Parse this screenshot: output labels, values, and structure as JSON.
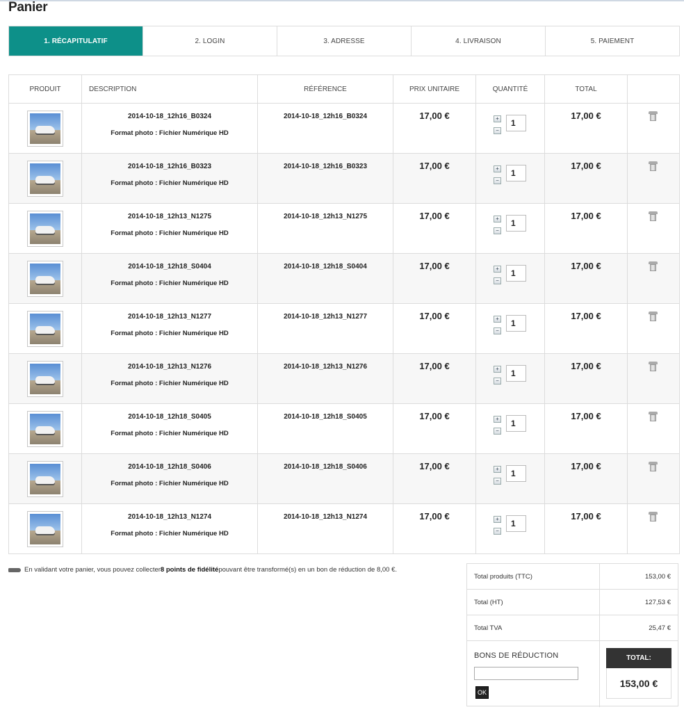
{
  "page": {
    "title": "Panier"
  },
  "steps": [
    {
      "label": "1. Récapitulatif",
      "active": true
    },
    {
      "label": "2. Login",
      "active": false
    },
    {
      "label": "3. Adresse",
      "active": false
    },
    {
      "label": "4. Livraison",
      "active": false
    },
    {
      "label": "5. Paiement",
      "active": false
    }
  ],
  "table": {
    "headers": {
      "product": "Produit",
      "description": "Description",
      "reference": "Référence",
      "unit_price": "Prix unitaire",
      "quantity": "Quantité",
      "total": "Total"
    },
    "plus_glyph": "+",
    "minus_glyph": "−",
    "rows": [
      {
        "name": "2014-10-18_12h16_B0324",
        "format": "Format photo : Fichier Numérique HD",
        "reference": "2014-10-18_12h16_B0324",
        "unit_price": "17,00 €",
        "quantity": "1",
        "total": "17,00 €"
      },
      {
        "name": "2014-10-18_12h16_B0323",
        "format": "Format photo : Fichier Numérique HD",
        "reference": "2014-10-18_12h16_B0323",
        "unit_price": "17,00 €",
        "quantity": "1",
        "total": "17,00 €"
      },
      {
        "name": "2014-10-18_12h13_N1275",
        "format": "Format photo : Fichier Numérique HD",
        "reference": "2014-10-18_12h13_N1275",
        "unit_price": "17,00 €",
        "quantity": "1",
        "total": "17,00 €"
      },
      {
        "name": "2014-10-18_12h18_S0404",
        "format": "Format photo : Fichier Numérique HD",
        "reference": "2014-10-18_12h18_S0404",
        "unit_price": "17,00 €",
        "quantity": "1",
        "total": "17,00 €"
      },
      {
        "name": "2014-10-18_12h13_N1277",
        "format": "Format photo : Fichier Numérique HD",
        "reference": "2014-10-18_12h13_N1277",
        "unit_price": "17,00 €",
        "quantity": "1",
        "total": "17,00 €"
      },
      {
        "name": "2014-10-18_12h13_N1276",
        "format": "Format photo : Fichier Numérique HD",
        "reference": "2014-10-18_12h13_N1276",
        "unit_price": "17,00 €",
        "quantity": "1",
        "total": "17,00 €"
      },
      {
        "name": "2014-10-18_12h18_S0405",
        "format": "Format photo : Fichier Numérique HD",
        "reference": "2014-10-18_12h18_S0405",
        "unit_price": "17,00 €",
        "quantity": "1",
        "total": "17,00 €"
      },
      {
        "name": "2014-10-18_12h18_S0406",
        "format": "Format photo : Fichier Numérique HD",
        "reference": "2014-10-18_12h18_S0406",
        "unit_price": "17,00 €",
        "quantity": "1",
        "total": "17,00 €"
      },
      {
        "name": "2014-10-18_12h13_N1274",
        "format": "Format photo : Fichier Numérique HD",
        "reference": "2014-10-18_12h13_N1274",
        "unit_price": "17,00 €",
        "quantity": "1",
        "total": "17,00 €"
      }
    ]
  },
  "loyalty": {
    "before": "En validant votre panier, vous pouvez collecter ",
    "points": "8 points de fidélité",
    "after": " pouvant être transformé(s) en un bon de réduction de 8,00 €."
  },
  "totals": {
    "products_ttc_label": "Total produits (TTC)",
    "products_ttc_value": "153,00 €",
    "ht_label": "Total (HT)",
    "ht_value": "127,53 €",
    "tva_label": "Total TVA",
    "tva_value": "25,47 €",
    "voucher_title": "Bons de réduction",
    "voucher_placeholder": "",
    "ok_label": "OK",
    "grand_label": "Total:",
    "grand_value": "153,00 €"
  },
  "colors": {
    "accent": "#0d9089",
    "dark": "#333333",
    "border": "#dcdcdc"
  }
}
